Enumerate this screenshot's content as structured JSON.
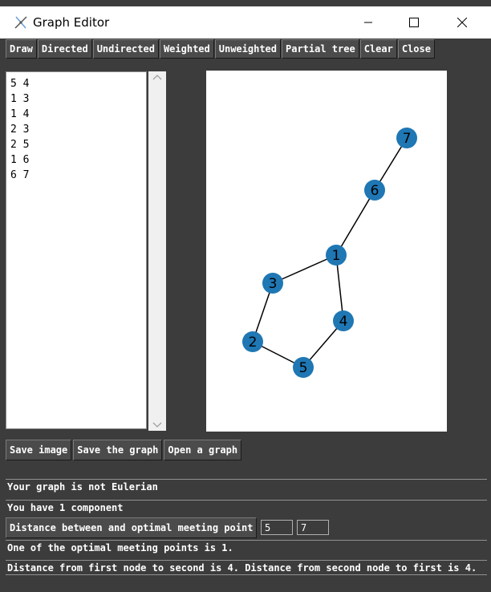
{
  "window": {
    "title": "Graph Editor"
  },
  "toolbar": [
    "Draw",
    "Directed",
    "Undirected",
    "Weighted",
    "Unweighted",
    "Partial tree",
    "Clear",
    "Close"
  ],
  "editor": {
    "lines": [
      "5 4",
      "1 3",
      "1 4",
      "2 3",
      "2 5",
      "1 6",
      "6 7"
    ]
  },
  "graph": {
    "node_color": "#1f77b4",
    "nodes": [
      "1",
      "2",
      "3",
      "4",
      "5",
      "6",
      "7"
    ],
    "edges": [
      [
        "5",
        "4"
      ],
      [
        "1",
        "3"
      ],
      [
        "1",
        "4"
      ],
      [
        "2",
        "3"
      ],
      [
        "2",
        "5"
      ],
      [
        "1",
        "6"
      ],
      [
        "6",
        "7"
      ]
    ]
  },
  "file_buttons": [
    "Save image",
    "Save the graph",
    "Open a graph"
  ],
  "status": {
    "eulerian": "Your graph is not Eulerian",
    "components": "You have 1 component"
  },
  "distance": {
    "button_label": "Distance between and optimal meeting point",
    "from": "5",
    "to": "7",
    "optimal": "One of the optimal meeting points is 1.",
    "result": "Distance from first node to second is 4. Distance from second node to first is 4."
  }
}
